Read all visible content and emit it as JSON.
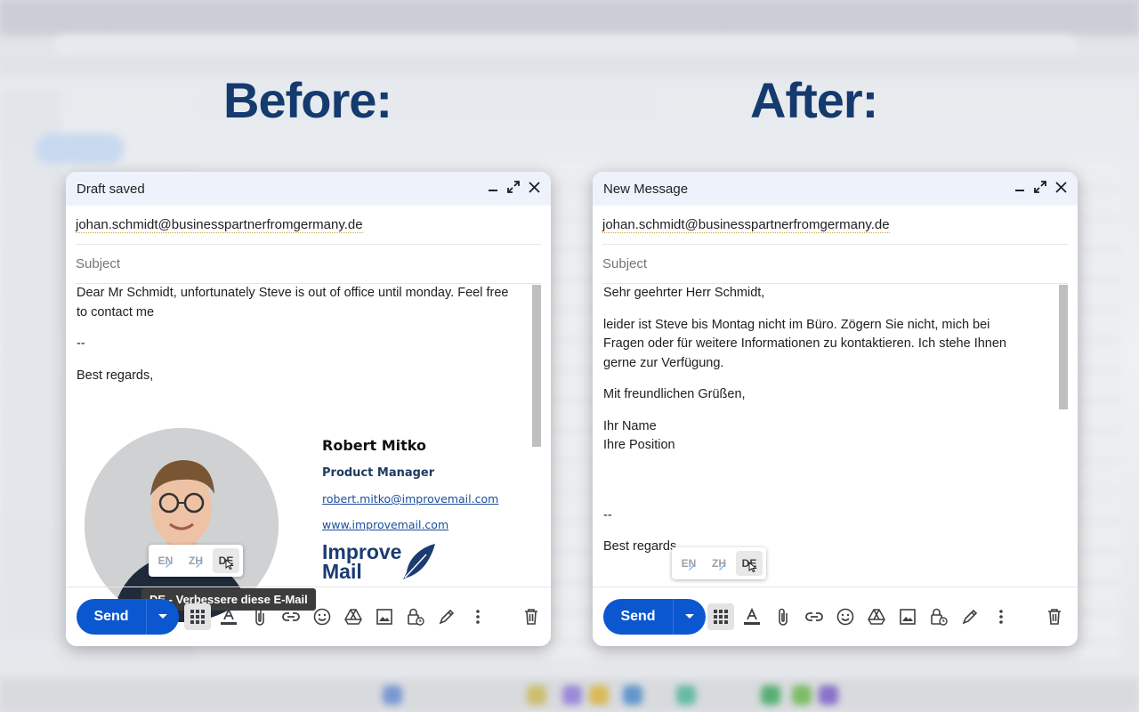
{
  "labels": {
    "before": "Before:",
    "after": "After:"
  },
  "before": {
    "title": "Draft saved",
    "to": "johan.schmidt@businesspartnerfromgermany.de",
    "subject_placeholder": "Subject",
    "body": [
      "Dear Mr Schmidt, unfortunately Steve is out of office until monday. Feel free to contact me",
      "--",
      "Best regards,"
    ],
    "signature": {
      "name": "Robert Mitko",
      "role": "Product Manager",
      "email": "robert.mitko@improvemail.com",
      "website": "www.improvemail.com",
      "logo_line1": "Improve",
      "logo_line2": "Mail"
    },
    "tooltip": "DE - Verbessere diese E-Mail"
  },
  "after": {
    "title": "New Message",
    "to": "johan.schmidt@businesspartnerfromgermany.de",
    "subject_placeholder": "Subject",
    "body": [
      "Sehr geehrter Herr Schmidt,",
      "leider ist Steve bis Montag nicht im Büro. Zögern Sie nicht, mich bei Fragen oder für weitere Informationen zu kontaktieren. Ich stehe Ihnen gerne zur Verfügung.",
      "Mit freundlichen Grüßen,",
      "Ihr Name",
      "Ihre Position",
      "--",
      "Best regards"
    ]
  },
  "languages": [
    "EN",
    "ZH",
    "DE"
  ],
  "active_language": "DE",
  "send_label": "Send",
  "window_controls": [
    "minimize-icon",
    "expand-icon",
    "close-icon"
  ],
  "toolbar_icons": [
    "apps-icon",
    "text-format-icon",
    "attach-icon",
    "link-icon",
    "emoji-icon",
    "drive-icon",
    "image-icon",
    "confidential-lock-icon",
    "signature-pen-icon",
    "more-options-icon",
    "trash-icon"
  ],
  "colors": {
    "accent": "#0b57d0",
    "headline": "#143a6e",
    "header_bg": "#eef3fb"
  }
}
